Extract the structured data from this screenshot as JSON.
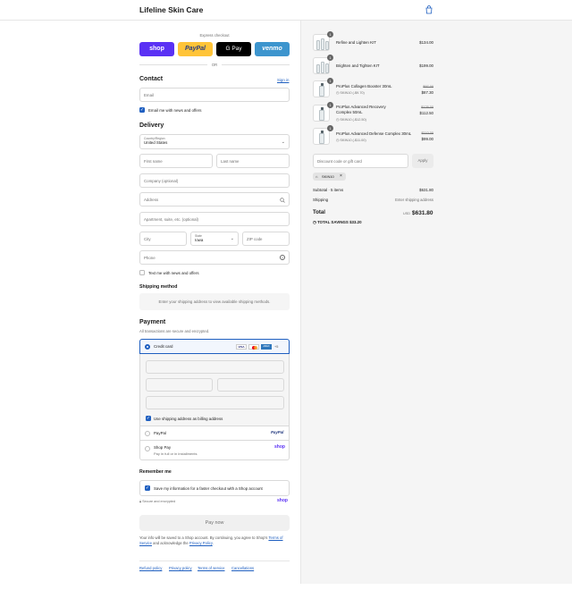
{
  "header": {
    "brand": "Lifeline Skin Care",
    "cart_icon": "shopping-bag-icon"
  },
  "express": {
    "label": "Express checkout",
    "buttons": [
      {
        "label": "shop",
        "color": "#5a31f4"
      },
      {
        "label": "PayPal",
        "color": "#ffc439"
      },
      {
        "label": "G Pay",
        "color": "#000000"
      },
      {
        "label": "venmo",
        "color": "#3d95ce"
      }
    ],
    "or": "OR"
  },
  "contact": {
    "title": "Contact",
    "signin": "Sign in",
    "email_placeholder": "Email",
    "news_label": "Email me with news and offers"
  },
  "delivery": {
    "title": "Delivery",
    "country_label": "Country/Region",
    "country_value": "United States",
    "first_name": "First name",
    "last_name": "Last name",
    "company": "Company (optional)",
    "address": "Address",
    "apartment": "Apartment, suite, etc. (optional)",
    "city": "City",
    "state_label": "State",
    "state_value": "Iowa",
    "zip": "ZIP code",
    "phone": "Phone",
    "text_label": "Text me with news and offers"
  },
  "shipping": {
    "title": "Shipping method",
    "message": "Enter your shipping address to view available shipping methods."
  },
  "payment": {
    "title": "Payment",
    "subtitle": "All transactions are secure and encrypted.",
    "credit_card": "Credit card",
    "cards": [
      "VISA",
      "MC",
      "AMEX",
      "+5"
    ],
    "billing_label": "Use shipping address as billing address",
    "paypal": "PayPal",
    "paypal_logo": "PayPal",
    "shoppay": "Shop Pay",
    "shoppay_sub": "Pay in full or in installments",
    "shoppay_logo": "shop"
  },
  "remember": {
    "title": "Remember me",
    "label": "Save my information for a faster checkout with a Shop account",
    "secure": "Secure and encrypted",
    "shop_logo": "shop"
  },
  "pay_button": "Pay now",
  "terms": {
    "prefix": "Your info will be saved to a Shop account. By continuing, you agree to Shop's",
    "terms_link": "Terms of Service",
    "middle": "and acknowledge the",
    "privacy_link": "Privacy Policy",
    "end": "."
  },
  "footer_links": [
    "Refund policy",
    "Privacy policy",
    "Terms of service",
    "Cancellations"
  ],
  "order": {
    "items": [
      {
        "name": "Refine and Lighten KIT",
        "qty": "1",
        "price": "$134.00"
      },
      {
        "name": "Brighten and Tighten KIT",
        "qty": "1",
        "price": "$199.00"
      },
      {
        "name": "ProPlus Collagen Booster 30mL",
        "qty": "1",
        "discount": "SKIN10 (-$9.70)",
        "original": "$97.00",
        "price": "$87.30"
      },
      {
        "name": "ProPlus Advanced Recovery Complex 50mL",
        "qty": "1",
        "discount": "SKIN10 (-$12.50)",
        "original": "$125.00",
        "price": "$112.50"
      },
      {
        "name": "ProPlus Advanced Defense Complex 30mL",
        "qty": "1",
        "discount": "SKIN10 (-$11.00)",
        "original": "$110.00",
        "price": "$99.00"
      }
    ],
    "discount_placeholder": "Discount code or gift card",
    "apply": "Apply",
    "code_tag": "SKIN10",
    "subtotal_label": "Subtotal · 5 items",
    "subtotal": "$631.80",
    "shipping_label": "Shipping",
    "shipping_value": "Enter shipping address",
    "total_label": "Total",
    "currency": "USD",
    "total": "$631.80",
    "savings_label": "TOTAL SAVINGS",
    "savings": "$33.20"
  }
}
